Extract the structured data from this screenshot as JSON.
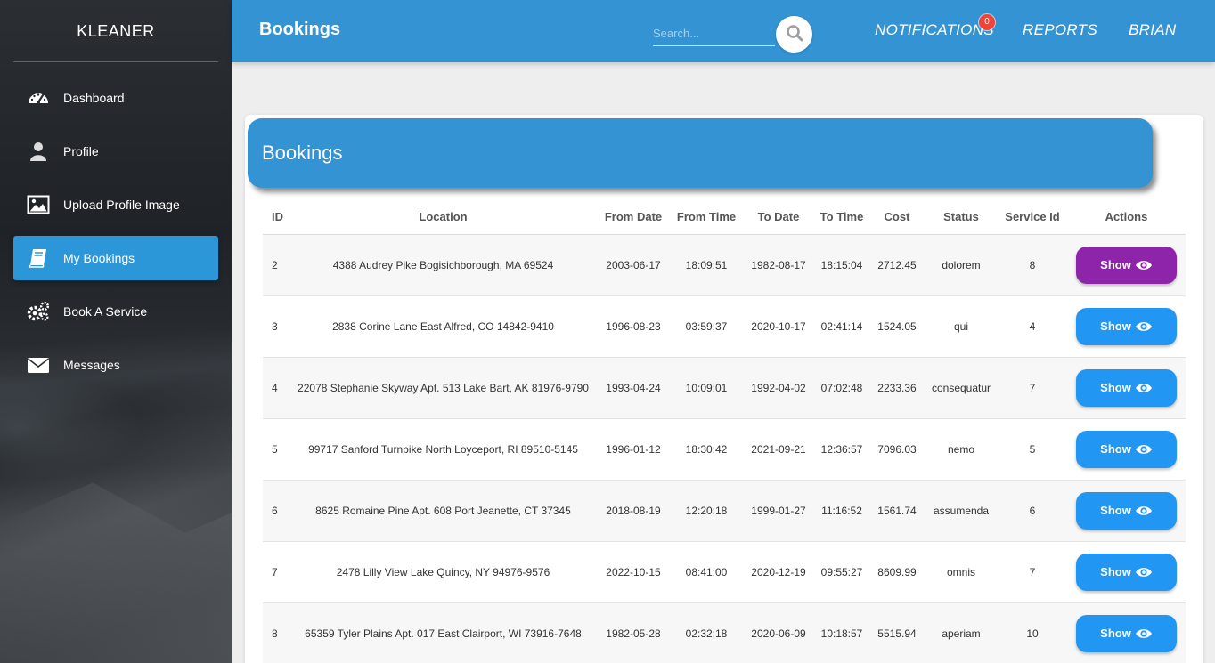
{
  "app": {
    "brand": "KLEANER"
  },
  "sidebar": {
    "items": [
      {
        "label": "Dashboard",
        "icon": "dashboard-gauge-icon"
      },
      {
        "label": "Profile",
        "icon": "user-icon"
      },
      {
        "label": "Upload Profile Image",
        "icon": "image-icon"
      },
      {
        "label": "My Bookings",
        "icon": "book-icon",
        "active": true
      },
      {
        "label": "Book A Service",
        "icon": "gears-icon"
      },
      {
        "label": "Messages",
        "icon": "envelope-icon"
      }
    ]
  },
  "header": {
    "title": "Bookings",
    "search_placeholder": "Search...",
    "notifications_label": "NOTIFICATIONS",
    "notifications_count": "0",
    "reports_label": "REPORTS",
    "user_label": "BRIAN"
  },
  "card": {
    "title": "Bookings"
  },
  "table": {
    "columns": [
      "ID",
      "Location",
      "From Date",
      "From Time",
      "To Date",
      "To Time",
      "Cost",
      "Status",
      "Service Id",
      "Actions"
    ],
    "action_label": "Show",
    "rows": [
      {
        "id": "2",
        "location": "4388 Audrey Pike Bogisichborough, MA 69524",
        "from_date": "2003-06-17",
        "from_time": "18:09:51",
        "to_date": "1982-08-17",
        "to_time": "18:15:04",
        "cost": "2712.45",
        "status": "dolorem",
        "service_id": "8"
      },
      {
        "id": "3",
        "location": "2838 Corine Lane East Alfred, CO 14842-9410",
        "from_date": "1996-08-23",
        "from_time": "03:59:37",
        "to_date": "2020-10-17",
        "to_time": "02:41:14",
        "cost": "1524.05",
        "status": "qui",
        "service_id": "4"
      },
      {
        "id": "4",
        "location": "22078 Stephanie Skyway Apt. 513 Lake Bart, AK 81976-9790",
        "from_date": "1993-04-24",
        "from_time": "10:09:01",
        "to_date": "1992-04-02",
        "to_time": "07:02:48",
        "cost": "2233.36",
        "status": "consequatur",
        "service_id": "7"
      },
      {
        "id": "5",
        "location": "99717 Sanford Turnpike North Loyceport, RI 89510-5145",
        "from_date": "1996-01-12",
        "from_time": "18:30:42",
        "to_date": "2021-09-21",
        "to_time": "12:36:57",
        "cost": "7096.03",
        "status": "nemo",
        "service_id": "5"
      },
      {
        "id": "6",
        "location": "8625 Romaine Pine Apt. 608 Port Jeanette, CT 37345",
        "from_date": "2018-08-19",
        "from_time": "12:20:18",
        "to_date": "1999-01-27",
        "to_time": "11:16:52",
        "cost": "1561.74",
        "status": "assumenda",
        "service_id": "6"
      },
      {
        "id": "7",
        "location": "2478 Lilly View Lake Quincy, NY 94976-9576",
        "from_date": "2022-10-15",
        "from_time": "08:41:00",
        "to_date": "2020-12-19",
        "to_time": "09:55:27",
        "cost": "8609.99",
        "status": "omnis",
        "service_id": "7"
      },
      {
        "id": "8",
        "location": "65359 Tyler Plains Apt. 017 East Clairport, WI 73916-7648",
        "from_date": "1982-05-28",
        "from_time": "02:32:18",
        "to_date": "2020-06-09",
        "to_time": "10:18:57",
        "cost": "5515.94",
        "status": "aperiam",
        "service_id": "10"
      }
    ]
  },
  "colors": {
    "primary": "#3494d3",
    "button": "#2196f3",
    "button_active": "#8e24aa",
    "badge": "#f44336"
  }
}
